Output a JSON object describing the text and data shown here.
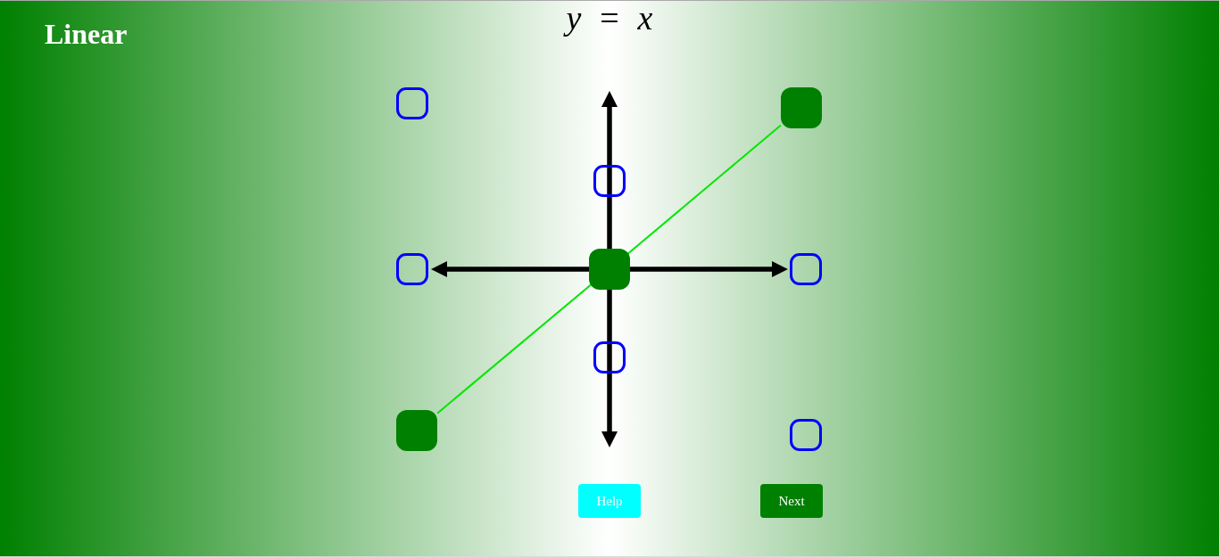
{
  "title": "Linear",
  "equation": "*y* = *x*",
  "graph": {
    "points": [
      {
        "selected": false
      },
      {
        "selected": true
      },
      {
        "selected": false
      },
      {
        "selected": false
      },
      {
        "selected": true
      },
      {
        "selected": false
      },
      {
        "selected": false
      },
      {
        "selected": true
      },
      {
        "selected": false
      }
    ]
  },
  "buttons": [
    {
      "label": "Help",
      "kind": "help"
    },
    {
      "label": "Next",
      "kind": "next"
    }
  ]
}
